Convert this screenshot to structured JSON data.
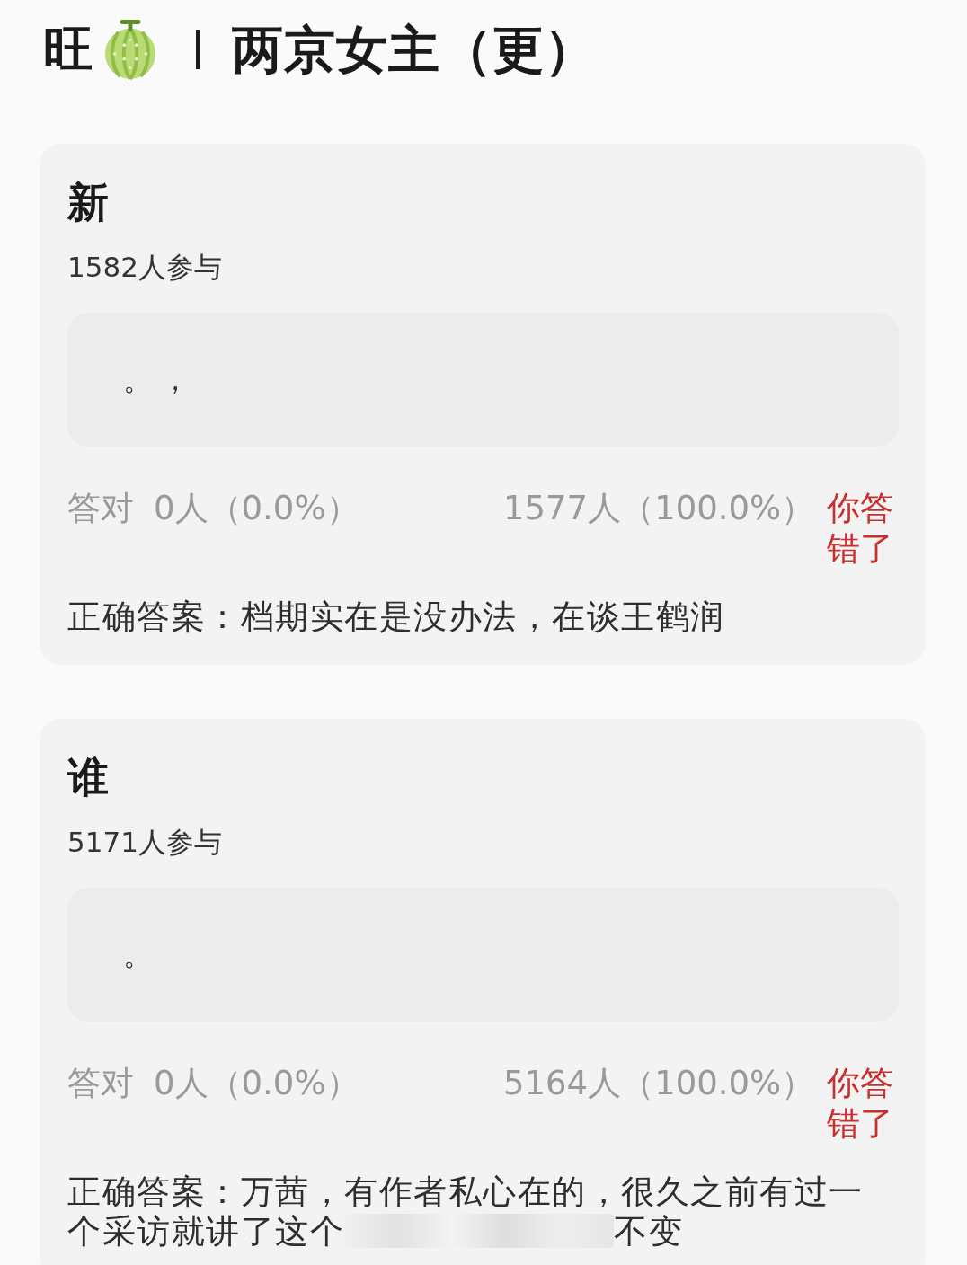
{
  "header": {
    "prefix": "旺",
    "title": "两京女主（更）"
  },
  "quizzes": [
    {
      "title": "新",
      "participants": "1582人参与",
      "option": {
        "text": "。 ，"
      },
      "stats": {
        "correct_label": "答对",
        "correct": "0人（0.0%）",
        "other": "1577人（100.0%）"
      },
      "result": {
        "kind": "wrong",
        "text": "你答错了"
      },
      "answer_label": "正确答案：",
      "answer": [
        {
          "kind": "text",
          "text": "档期实在是没办法，在谈王鹤润"
        }
      ]
    },
    {
      "title": "谁",
      "participants": "5171人参与",
      "option": {
        "text": "。"
      },
      "stats": {
        "correct_label": "答对",
        "correct": "0人（0.0%）",
        "other": "5164人（100.0%）"
      },
      "result": {
        "kind": "wrong",
        "text": "你答错了"
      },
      "answer_label": "正确答案：",
      "answer": [
        {
          "kind": "text",
          "text": "万茜，有作者私心在的，很久之前有过一个采访就讲了这个"
        },
        {
          "kind": "obscured"
        },
        {
          "kind": "text",
          "text": "不变"
        }
      ]
    }
  ]
}
